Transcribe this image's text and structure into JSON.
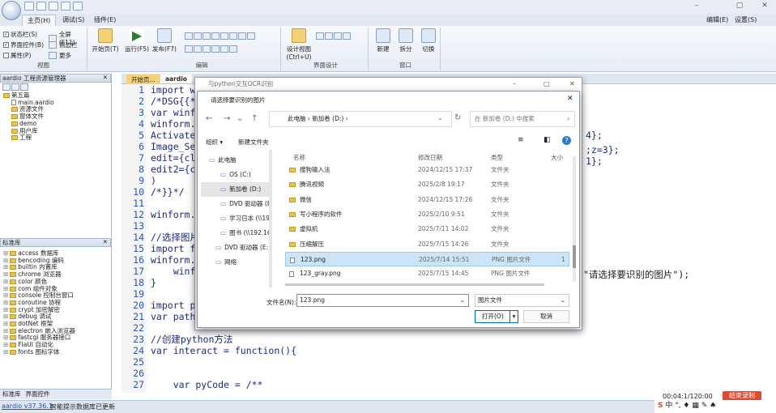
{
  "app": {
    "title_tabs": [
      "主页(H)",
      "调试(S)",
      "插件(E)"
    ],
    "right_menu": [
      "编辑(E)",
      "设置(S)"
    ],
    "win_min": "–",
    "win_max": "▢",
    "win_close": "✕"
  },
  "ribbon": {
    "view": {
      "checks": [
        {
          "label": "状态栏(S)",
          "checked": true
        },
        {
          "label": "界面控件(B)",
          "checked": true
        },
        {
          "label": "属性(P)",
          "checked": false
        }
      ],
      "opts": [
        "全屏(F11)",
        "侧边栏",
        "更多"
      ],
      "label": "视图"
    },
    "start_page": "开始页(T)",
    "run": "运行(F5)",
    "publish": "发布(F7)",
    "edit_label": "编辑",
    "design": "设计视图\n(Ctrl+U)",
    "ui_design_label": "界面设计",
    "new": "新建",
    "split": "拆分",
    "switch": "切换",
    "window_label": "窗口"
  },
  "project_panel": {
    "title": "aardio 工程资源管理器",
    "pin": "✕",
    "items": [
      {
        "label": "第五篇",
        "type": "folder",
        "indent": 0
      },
      {
        "label": "main.aardio",
        "type": "file",
        "indent": 1
      },
      {
        "label": "资源文件",
        "type": "folder",
        "indent": 1
      },
      {
        "label": "窗体文件",
        "type": "folder",
        "indent": 1
      },
      {
        "label": "demo",
        "type": "folder",
        "indent": 1
      },
      {
        "label": "用户库",
        "type": "folder",
        "indent": 1
      },
      {
        "label": "工程",
        "type": "folder",
        "indent": 1
      }
    ]
  },
  "lib_panel": {
    "title": "标准库",
    "pin": "✕",
    "items": [
      "access 数据库",
      "bencoding 编码",
      "builtin 内置库",
      "chrome 浏览器",
      "color 颜色",
      "com 组件对象",
      "console 控制台窗口",
      "coroutine 协程",
      "crypt 加密解密",
      "debug 调试",
      "dotNet 框架",
      "electron 嵌入浏览器",
      "fastcgi 服务器接口",
      "FlaUI 自动化",
      "fonts 图标字体"
    ],
    "tabs": [
      "标准库",
      "界面控件"
    ]
  },
  "editor": {
    "tabs": [
      "开始页...",
      "aardio"
    ],
    "line_numbers": [
      "1",
      "2",
      "3",
      "4",
      "5",
      "6",
      "7",
      "8",
      "9",
      "10",
      "11",
      "12",
      "13",
      "14",
      "15",
      "16",
      "17",
      "18",
      "19",
      "20",
      "21",
      "22",
      "23",
      "24",
      "25",
      "26",
      "27"
    ],
    "lines": [
      "import w",
      "/*DSG{{*",
      "var winf",
      "winform.",
      "Activate",
      "Image_Se",
      "edit={cl",
      "edit2={c",
      ")",
      "/*}}*/",
      "",
      "winform.",
      "",
      "//选择图片",
      "import f",
      "winform.",
      "    winf",
      "}",
      "",
      "import p",
      "var path",
      "",
      "//创建python方法",
      "var interact = function(){",
      "",
      "",
      "    var pyCode = /**"
    ],
    "right_frags": [
      "4};",
      ";z=3};",
      "1};",
      "\"请选择要识别的图片\");"
    ]
  },
  "ocr_window": {
    "title": "与python交互OCR识别",
    "min": "–",
    "max": "▢",
    "close": "✕"
  },
  "file_dialog": {
    "title": "请选择要识别的图片",
    "close": "✕",
    "breadcrumb": [
      "此电脑",
      "新加卷 (D:)"
    ],
    "search_placeholder": "在 新加卷 (D:) 中搜索",
    "organize": "组织 ▾",
    "new_folder": "新建文件夹",
    "nav": [
      "此电脑",
      "OS (C:)",
      "新加卷 (D:)",
      "DVD 驱动器 (E",
      "学习日本 (\\\\19",
      "图书 (\\\\192.16",
      "DVD 驱动器 (E:)",
      "网络"
    ],
    "columns": [
      "名称",
      "修改日期",
      "类型",
      "大小"
    ],
    "files": [
      {
        "name": "搜狗输入法",
        "date": "2024/12/15 17:37",
        "type": "文件夹"
      },
      {
        "name": "腾讯视频",
        "date": "2025/2/8 19:17",
        "type": "文件夹"
      },
      {
        "name": "微信",
        "date": "2024/12/15 17:26",
        "type": "文件夹"
      },
      {
        "name": "写小程序的软件",
        "date": "2025/2/10 9:51",
        "type": "文件夹"
      },
      {
        "name": "虚拟机",
        "date": "2025/7/11 14:02",
        "type": "文件夹"
      },
      {
        "name": "压缩解压",
        "date": "2025/7/15 14:26",
        "type": "文件夹"
      },
      {
        "name": "123.png",
        "date": "2025/7/14 15:51",
        "type": "PNG 图片文件",
        "size": "1"
      },
      {
        "name": "123_gray.png",
        "date": "2025/7/15 14:45",
        "type": "PNG 图片文件"
      }
    ],
    "filename_label": "文件名(N):",
    "filename_value": "123.png",
    "filetype": "图片文件",
    "open": "打开(O)",
    "cancel": "取消"
  },
  "status": {
    "version": "aardio v37.36.1",
    "message": "智能提示数据库已更新"
  },
  "tray": {
    "time": "00:04:1/120:00",
    "record": "结束录制"
  }
}
